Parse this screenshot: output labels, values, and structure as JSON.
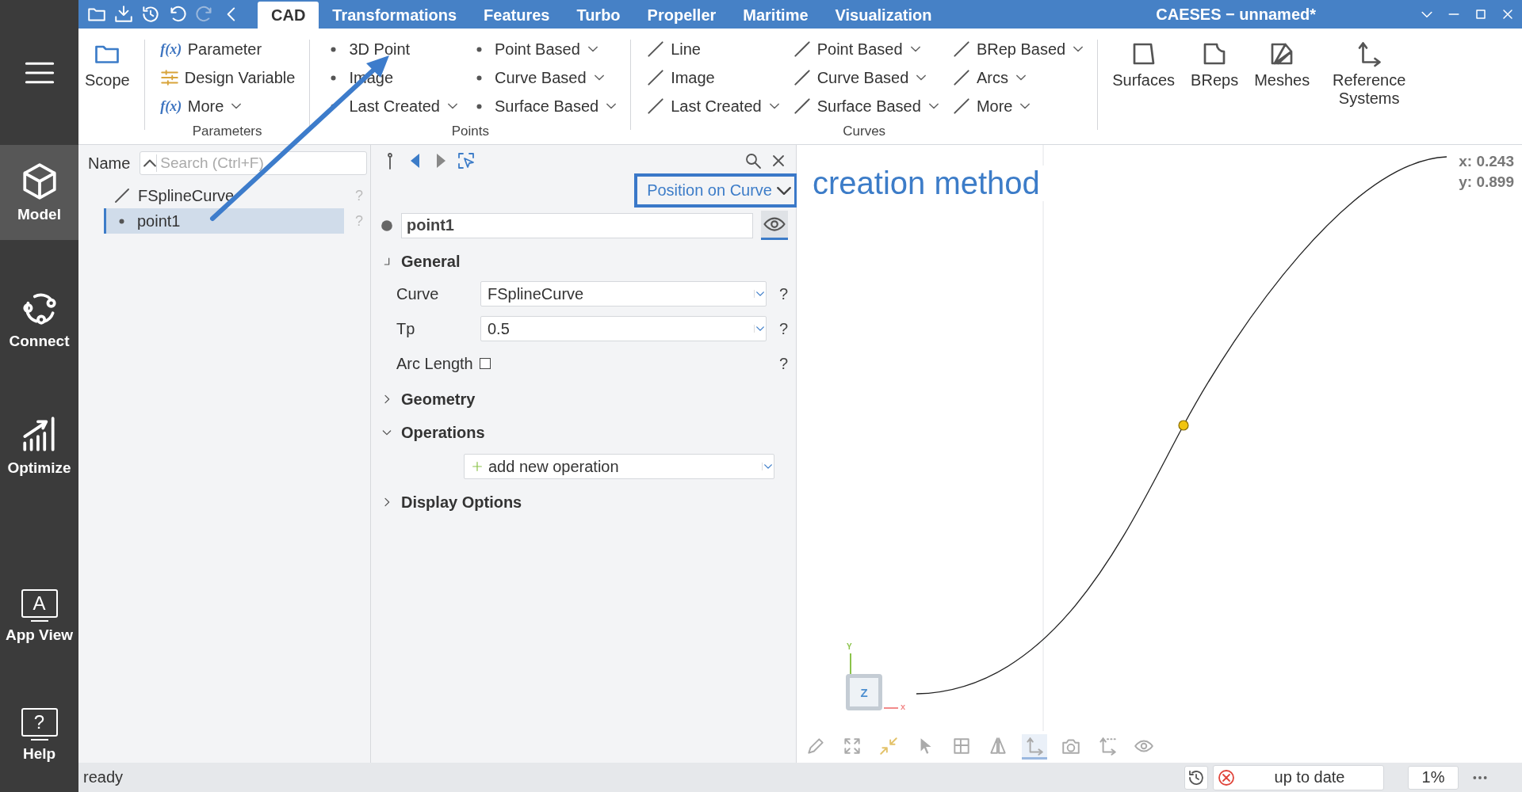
{
  "side_nav": {
    "items": [
      {
        "label": "Model",
        "selected": true
      },
      {
        "label": "Connect",
        "selected": false
      },
      {
        "label": "Optimize",
        "selected": false
      },
      {
        "label": "App View",
        "glyph": "A",
        "selected": false
      },
      {
        "label": "Help",
        "glyph": "?",
        "selected": false
      }
    ]
  },
  "title_bar": {
    "title": "CAESES − unnamed*",
    "tabs": [
      {
        "label": "CAD",
        "selected": true
      },
      {
        "label": "Transformations",
        "selected": false
      },
      {
        "label": "Features",
        "selected": false
      },
      {
        "label": "Turbo",
        "selected": false
      },
      {
        "label": "Propeller",
        "selected": false
      },
      {
        "label": "Maritime",
        "selected": false
      },
      {
        "label": "Visualization",
        "selected": false
      }
    ]
  },
  "ribbon": {
    "groups": [
      {
        "kind": "large",
        "items": [
          {
            "label": "Scope"
          }
        ]
      },
      {
        "kind": "list",
        "caption": "Parameters",
        "columns": [
          [
            {
              "label": "Parameter",
              "glyph": "f(x)",
              "dropdown": false
            },
            {
              "label": "Design Variable",
              "dropdown": false
            },
            {
              "label": "More",
              "glyph": "f(x)",
              "dropdown": true
            }
          ]
        ]
      },
      {
        "kind": "list",
        "caption": "Points",
        "columns": [
          [
            {
              "label": "3D Point",
              "dropdown": false
            },
            {
              "label": "Image",
              "dropdown": false
            },
            {
              "label": "Last Created",
              "dropdown": true
            }
          ],
          [
            {
              "label": "Point Based",
              "dropdown": true
            },
            {
              "label": "Curve Based",
              "dropdown": true
            },
            {
              "label": "Surface Based",
              "dropdown": true
            }
          ]
        ]
      },
      {
        "kind": "list",
        "caption": "Curves",
        "columns": [
          [
            {
              "label": "Line",
              "dropdown": false
            },
            {
              "label": "Image",
              "dropdown": false
            },
            {
              "label": "Last Created",
              "dropdown": true
            }
          ],
          [
            {
              "label": "Point Based",
              "dropdown": true
            },
            {
              "label": "Curve Based",
              "dropdown": true
            },
            {
              "label": "Surface Based",
              "dropdown": true
            }
          ],
          [
            {
              "label": "BRep Based",
              "dropdown": true
            },
            {
              "label": "Arcs",
              "dropdown": true
            },
            {
              "label": "More",
              "dropdown": true
            }
          ]
        ]
      },
      {
        "kind": "large",
        "items": [
          {
            "label": "Surfaces"
          },
          {
            "label": "BReps"
          },
          {
            "label": "Meshes"
          },
          {
            "label": "Reference Systems"
          }
        ]
      }
    ]
  },
  "tree": {
    "header": "Name",
    "search": {
      "placeholder": "Search (Ctrl+F)"
    },
    "items": [
      {
        "label": "FSplineCurve",
        "selected": false,
        "help": "?"
      },
      {
        "label": "point1",
        "selected": true,
        "help": "?"
      }
    ]
  },
  "properties": {
    "method": "Position on Curve",
    "name": "point1",
    "sections": [
      {
        "title": "General",
        "expanded": true,
        "fields": [
          {
            "kind": "combo",
            "label": "Curve",
            "value": "FSplineCurve",
            "help": "?"
          },
          {
            "kind": "combo",
            "label": "Tp",
            "value": "0.5",
            "help": "?"
          },
          {
            "kind": "checkbox",
            "label": "Arc Length",
            "checked": false,
            "help": "?"
          }
        ]
      },
      {
        "title": "Geometry",
        "expanded": false
      },
      {
        "title": "Operations",
        "expanded": true,
        "fields": [
          {
            "kind": "add",
            "value": "add new operation"
          }
        ]
      },
      {
        "title": "Display Options",
        "expanded": false
      }
    ]
  },
  "viewport": {
    "readout": [
      "x: 0.243",
      "y: 0.899"
    ],
    "axes": {
      "y": "Y",
      "z": "Z",
      "x": "x"
    },
    "annotation": "creation method",
    "toolbar": [
      {
        "selected": false
      },
      {
        "selected": false
      },
      {
        "selected": false
      },
      {
        "selected": false
      },
      {
        "selected": false
      },
      {
        "selected": false
      },
      {
        "selected": true
      },
      {
        "selected": false
      },
      {
        "selected": false
      },
      {
        "selected": false
      }
    ]
  },
  "status_bar": {
    "text": "ready",
    "state": "up to date",
    "progress": "1%"
  }
}
